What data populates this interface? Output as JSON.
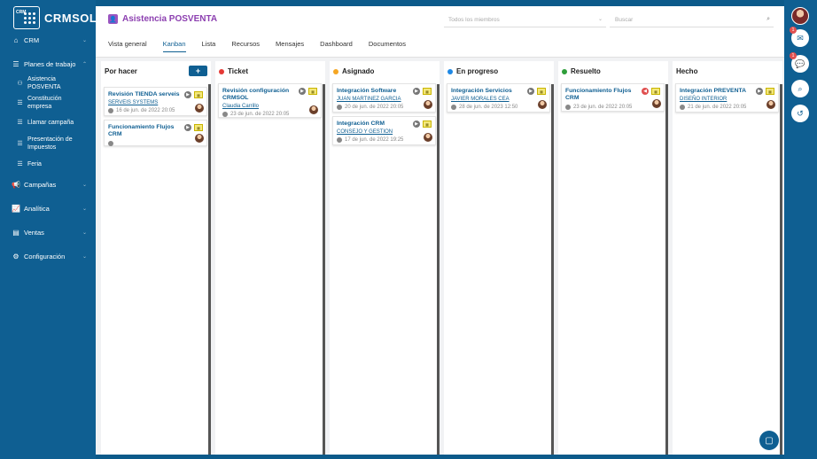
{
  "app": {
    "logo_small": "CRM",
    "logo_text": "CRMSOL"
  },
  "sidebar": {
    "items": [
      {
        "label": "CRM",
        "icon": "home-icon"
      },
      {
        "label": "Planes de trabajo",
        "icon": "list-icon"
      }
    ],
    "subitems": [
      {
        "label": "Asistencia POSVENTA",
        "icon": "users-icon"
      },
      {
        "label": "Constitución empresa",
        "icon": "list-icon"
      },
      {
        "label": "Llamar campaña",
        "icon": "list-icon"
      },
      {
        "label": "Presentación de Impuestos",
        "icon": "list-icon"
      },
      {
        "label": "Feria",
        "icon": "list-icon"
      }
    ],
    "bottom_items": [
      {
        "label": "Campañas",
        "icon": "megaphone-icon"
      },
      {
        "label": "Analítica",
        "icon": "chart-icon"
      },
      {
        "label": "Ventas",
        "icon": "document-icon"
      },
      {
        "label": "Configuración",
        "icon": "gear-icon"
      }
    ]
  },
  "header": {
    "title": "Asistencia POSVENTA",
    "members_placeholder": "Todos los miembros",
    "search_placeholder": "Buscar",
    "tabs": [
      "Vista general",
      "Kanban",
      "Lista",
      "Recursos",
      "Mensajes",
      "Dashboard",
      "Documentos"
    ],
    "active_tab": "Kanban"
  },
  "board": {
    "add_label": "+",
    "columns": [
      {
        "title": "Por hacer",
        "dot": "",
        "cards": [
          {
            "title": "Revisión TIENDA serveis",
            "sub": "SERVEIS SYSTEMS",
            "date": "16 de jun. de 2022 20:05"
          },
          {
            "title": "Funcionamiento Flujos CRM",
            "sub": "",
            "date": ""
          }
        ]
      },
      {
        "title": "Ticket",
        "dot": "#e53935",
        "cards": [
          {
            "title": "Revisión configuración CRMSOL",
            "sub": "Claudia Carrillo",
            "date": "23 de jun. de 2022 20:05"
          }
        ]
      },
      {
        "title": "Asignado",
        "dot": "#f5a623",
        "cards": [
          {
            "title": "Integración Software",
            "sub": "JUAN MARTINEZ GARCIA",
            "date": "20 de jun. de 2022 20:05"
          },
          {
            "title": "Integración CRM",
            "sub": "CONSEJO Y GESTION",
            "date": "17 de jun. de 2022 19:25"
          }
        ]
      },
      {
        "title": "En progreso",
        "dot": "#1e88e5",
        "cards": [
          {
            "title": "Integración Servicios",
            "sub": "JAVIER MORALES CEA",
            "date": "28 de jun. de 2023 12:50"
          }
        ]
      },
      {
        "title": "Resuelto",
        "dot": "#2e9e3a",
        "cards": [
          {
            "title": "Funcionamiento Flujos CRM",
            "sub": "",
            "date": "23 de jun. de 2022 20:05"
          }
        ]
      },
      {
        "title": "Hecho",
        "dot": "",
        "cards": [
          {
            "title": "Integración PREVENTA",
            "sub": "DISEÑO INTERIOR",
            "date": "21 de jun. de 2022 20:05"
          }
        ]
      }
    ]
  },
  "right_rail": {
    "badges": [
      "1",
      "1"
    ]
  },
  "colors": {
    "brand": "#0f5f92",
    "title": "#8c3fb0"
  }
}
